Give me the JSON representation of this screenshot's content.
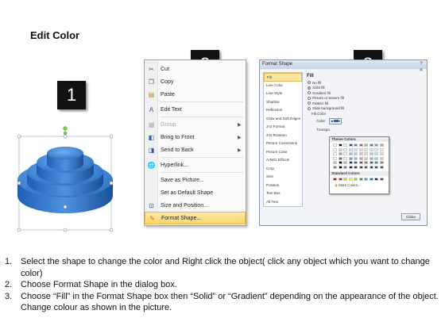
{
  "title": "Edit Color",
  "step_numbers": [
    "1",
    "2",
    "3"
  ],
  "context_menu": {
    "items": [
      {
        "label": "Cut",
        "icon": "scissors-icon",
        "disabled": false
      },
      {
        "label": "Copy",
        "icon": "copy-icon",
        "disabled": false
      },
      {
        "label": "Paste",
        "icon": "paste-icon",
        "disabled": false
      },
      {
        "label": "Edit Text",
        "icon": "edit-text-icon",
        "disabled": false
      },
      {
        "label": "Group",
        "icon": "group-icon",
        "disabled": true
      },
      {
        "label": "Bring to Front",
        "icon": "bring-front-icon",
        "disabled": false
      },
      {
        "label": "Send to Back",
        "icon": "send-back-icon",
        "disabled": false
      },
      {
        "label": "Hyperlink...",
        "icon": "hyperlink-icon",
        "disabled": false
      },
      {
        "label": "Save as Picture...",
        "icon": "",
        "disabled": false
      },
      {
        "label": "Set as Default Shape",
        "icon": "",
        "disabled": false
      },
      {
        "label": "Size and Position...",
        "icon": "size-position-icon",
        "disabled": false
      },
      {
        "label": "Format Shape...",
        "icon": "format-shape-icon",
        "disabled": false
      }
    ]
  },
  "dialog": {
    "title": "Format Shape",
    "close_button": "Close",
    "categories": [
      "Fill",
      "Line Color",
      "Line Style",
      "Shadow",
      "Reflection",
      "Glow and Soft Edges",
      "3-D Format",
      "3-D Rotation",
      "Picture Corrections",
      "Picture Color",
      "Artistic Effects",
      "Crop",
      "Size",
      "Position",
      "Text Box",
      "Alt Text"
    ],
    "selected_category": "Fill",
    "fill_heading": "Fill",
    "fill_options": [
      "No fill",
      "Solid fill",
      "Gradient fill",
      "Picture or texture fill",
      "Pattern fill",
      "Slide background fill"
    ],
    "selected_fill": "Solid fill",
    "fill_color_label": "Fill Color",
    "color_label": "Color:",
    "transparency_label": "Transpa",
    "palette": {
      "theme_heading": "Theme Colors",
      "standard_heading": "Standard Colors",
      "more_colors": "More Colors...",
      "theme_colors": [
        "#ffffff",
        "#000000",
        "#eeece1",
        "#1f497d",
        "#4f81bd",
        "#c0504d",
        "#9bbb59",
        "#8064a2",
        "#4bacc6",
        "#f79646"
      ],
      "standard_colors": [
        "#c00000",
        "#ff0000",
        "#ffc000",
        "#ffff00",
        "#92d050",
        "#00b050",
        "#00b0f0",
        "#0070c0",
        "#002060",
        "#7030a0"
      ]
    }
  },
  "instructions": [
    {
      "num": "1.",
      "text": "Select the shape to change the color and Right click the object( click any object which you want to change color)"
    },
    {
      "num": "2.",
      "text": "Choose Format Shape in the dialog box."
    },
    {
      "num": "3.",
      "text": "Choose “Fill” in the Format Shape box then “Solid” or “Gradient” depending on the appearance of the object. Change colour as shown in the picture."
    }
  ]
}
